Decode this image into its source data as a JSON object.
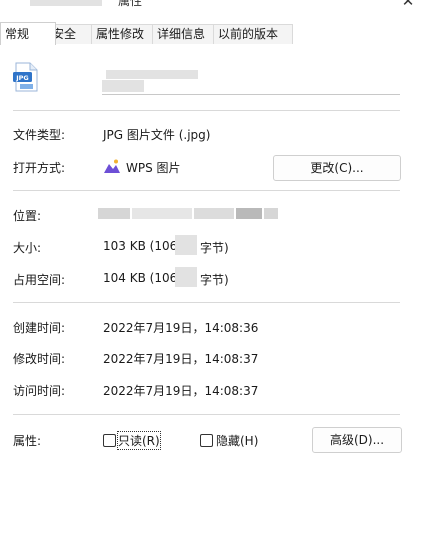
{
  "window": {
    "title": "属性",
    "close_glyph": "✕"
  },
  "tabs": [
    {
      "label": "常规",
      "active": true
    },
    {
      "label": "安全",
      "active": false
    },
    {
      "label": "属性修改",
      "active": false
    },
    {
      "label": "详细信息",
      "active": false
    },
    {
      "label": "以前的版本",
      "active": false
    }
  ],
  "file": {
    "icon_badge": "JPG",
    "icon": "jpg-file-icon"
  },
  "type_row": {
    "label": "文件类型:",
    "value": "JPG 图片文件 (.jpg)"
  },
  "open_row": {
    "label": "打开方式:",
    "app": "WPS 图片",
    "app_icon": "wps-picture-icon",
    "change_button": "更改(C)..."
  },
  "location_row": {
    "label": "位置:"
  },
  "size_row": {
    "label": "大小:",
    "value_prefix": "103 KB (106,",
    "value_suffix": "字节)"
  },
  "disk_row": {
    "label": "占用空间:",
    "value_prefix": "104 KB (106,",
    "value_suffix": "字节)"
  },
  "created_row": {
    "label": "创建时间:",
    "value": "2022年7月19日，14:08:36"
  },
  "modified_row": {
    "label": "修改时间:",
    "value": "2022年7月19日，14:08:37"
  },
  "accessed_row": {
    "label": "访问时间:",
    "value": "2022年7月19日，14:08:37"
  },
  "attributes": {
    "label": "属性:",
    "readonly": {
      "label": "只读(R)",
      "checked": false
    },
    "hidden": {
      "label": "隐藏(H)",
      "checked": false
    },
    "advanced_button": "高级(D)..."
  },
  "colors": {
    "separator": "#d9d9d9",
    "button_border": "#cfcfcf",
    "icon_blue": "#2f74c9"
  }
}
